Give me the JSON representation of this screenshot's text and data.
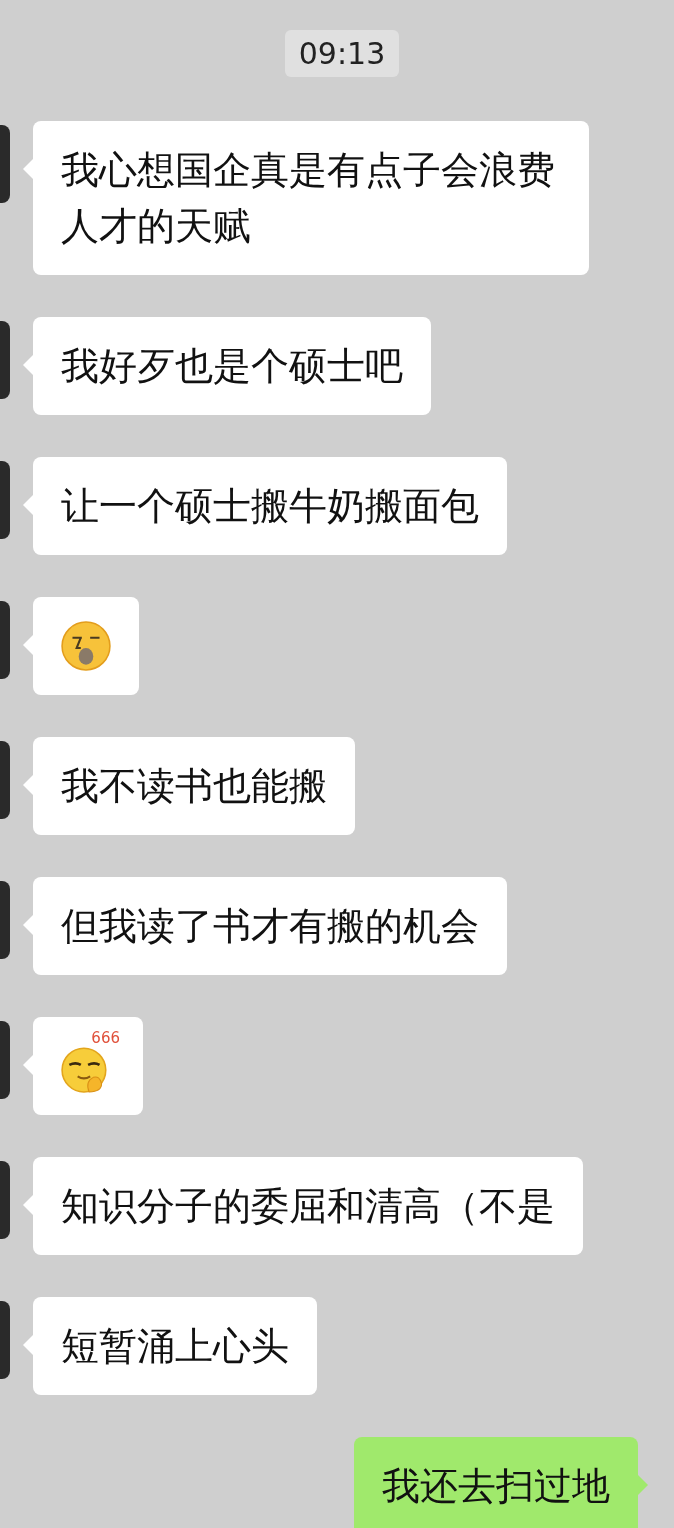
{
  "timestamp": "09:13",
  "messages": [
    {
      "outgoing": false,
      "kind": "text",
      "text": "我心想国企真是有点子会浪费人才的天赋"
    },
    {
      "outgoing": false,
      "kind": "text",
      "text": "我好歹也是个硕士吧"
    },
    {
      "outgoing": false,
      "kind": "text",
      "text": "让一个硕士搬牛奶搬面包"
    },
    {
      "outgoing": false,
      "kind": "sleepy"
    },
    {
      "outgoing": false,
      "kind": "text",
      "text": "我不读书也能搬"
    },
    {
      "outgoing": false,
      "kind": "text",
      "text": "但我读了书才有搬的机会"
    },
    {
      "outgoing": false,
      "kind": "smirk",
      "label": "666"
    },
    {
      "outgoing": false,
      "kind": "text",
      "text": "知识分子的委屈和清高（不是"
    },
    {
      "outgoing": false,
      "kind": "text",
      "text": "短暂涌上心头"
    },
    {
      "outgoing": true,
      "kind": "text",
      "text": "我还去扫过地"
    }
  ]
}
